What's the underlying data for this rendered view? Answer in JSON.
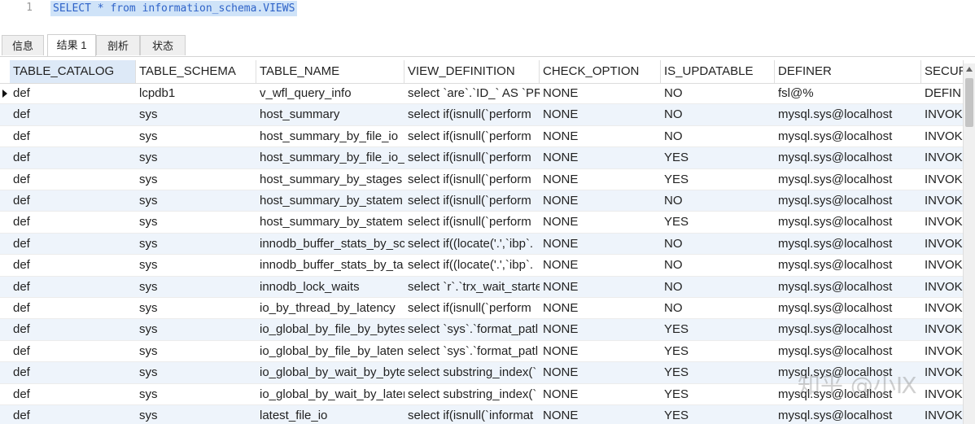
{
  "editor": {
    "line_number": "1",
    "query": "SELECT * from information_schema.VIEWS"
  },
  "tabs": [
    {
      "label": "信息",
      "active": false
    },
    {
      "label": "结果 1",
      "active": true
    },
    {
      "label": "剖析",
      "active": false
    },
    {
      "label": "状态",
      "active": false
    }
  ],
  "grid": {
    "columns": [
      "TABLE_CATALOG",
      "TABLE_SCHEMA",
      "TABLE_NAME",
      "VIEW_DEFINITION",
      "CHECK_OPTION",
      "IS_UPDATABLE",
      "DEFINER",
      "SECUR"
    ],
    "rows": [
      [
        "def",
        "lcpdb1",
        "v_wfl_query_info",
        "select `are`.`ID_` AS `PR",
        "NONE",
        "NO",
        "fsl@%",
        "DEFIN"
      ],
      [
        "def",
        "sys",
        "host_summary",
        "select if(isnull(`perform",
        "NONE",
        "NO",
        "mysql.sys@localhost",
        "INVOK"
      ],
      [
        "def",
        "sys",
        "host_summary_by_file_io",
        "select if(isnull(`perform",
        "NONE",
        "NO",
        "mysql.sys@localhost",
        "INVOK"
      ],
      [
        "def",
        "sys",
        "host_summary_by_file_io_t",
        "select if(isnull(`perform",
        "NONE",
        "YES",
        "mysql.sys@localhost",
        "INVOK"
      ],
      [
        "def",
        "sys",
        "host_summary_by_stages",
        "select if(isnull(`perform",
        "NONE",
        "YES",
        "mysql.sys@localhost",
        "INVOK"
      ],
      [
        "def",
        "sys",
        "host_summary_by_statem",
        "select if(isnull(`perform",
        "NONE",
        "NO",
        "mysql.sys@localhost",
        "INVOK"
      ],
      [
        "def",
        "sys",
        "host_summary_by_statem",
        "select if(isnull(`perform",
        "NONE",
        "YES",
        "mysql.sys@localhost",
        "INVOK"
      ],
      [
        "def",
        "sys",
        "innodb_buffer_stats_by_sc",
        "select if((locate('.',`ibp`.",
        "NONE",
        "NO",
        "mysql.sys@localhost",
        "INVOK"
      ],
      [
        "def",
        "sys",
        "innodb_buffer_stats_by_ta",
        "select if((locate('.',`ibp`.",
        "NONE",
        "NO",
        "mysql.sys@localhost",
        "INVOK"
      ],
      [
        "def",
        "sys",
        "innodb_lock_waits",
        "select `r`.`trx_wait_starte",
        "NONE",
        "NO",
        "mysql.sys@localhost",
        "INVOK"
      ],
      [
        "def",
        "sys",
        "io_by_thread_by_latency",
        "select if(isnull(`perform",
        "NONE",
        "NO",
        "mysql.sys@localhost",
        "INVOK"
      ],
      [
        "def",
        "sys",
        "io_global_by_file_by_bytes",
        "select `sys`.`format_patl",
        "NONE",
        "YES",
        "mysql.sys@localhost",
        "INVOK"
      ],
      [
        "def",
        "sys",
        "io_global_by_file_by_laten",
        "select `sys`.`format_patl",
        "NONE",
        "YES",
        "mysql.sys@localhost",
        "INVOK"
      ],
      [
        "def",
        "sys",
        "io_global_by_wait_by_byte",
        "select substring_index(`",
        "NONE",
        "YES",
        "mysql.sys@localhost",
        "INVOK"
      ],
      [
        "def",
        "sys",
        "io_global_by_wait_by_later",
        "select substring_index(`",
        "NONE",
        "YES",
        "mysql.sys@localhost",
        "INVOK"
      ],
      [
        "def",
        "sys",
        "latest_file_io",
        "select if(isnull(`informat",
        "NONE",
        "YES",
        "mysql.sys@localhost",
        "INVOK"
      ]
    ]
  },
  "watermark": "知乎 @小Ⅸ"
}
